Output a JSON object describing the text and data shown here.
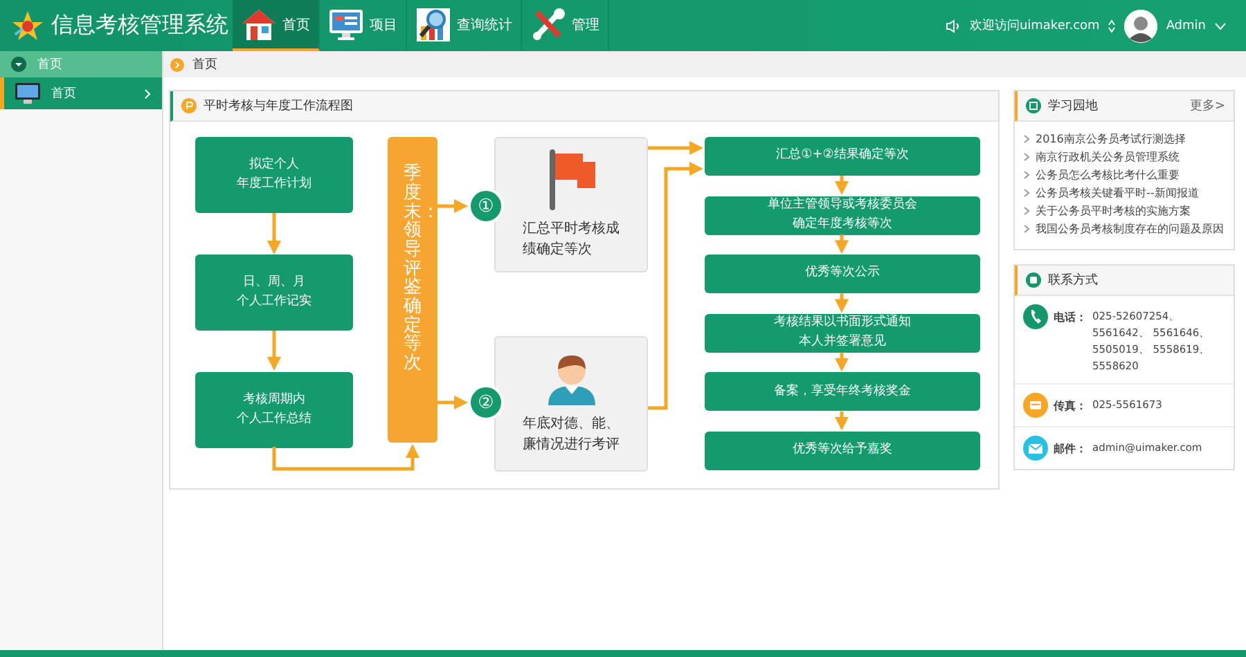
{
  "header": {
    "title": "信息考核管理系统",
    "nav": [
      {
        "label": "首页",
        "kind": "home",
        "selected": true
      },
      {
        "label": "项目",
        "kind": "project",
        "selected": false
      },
      {
        "label": "查询统计",
        "kind": "stats",
        "selected": false
      },
      {
        "label": "管理",
        "kind": "tools",
        "selected": false
      }
    ],
    "welcome": "欢迎访问uimaker.com",
    "user": "Admin"
  },
  "sidebar": {
    "section": "首页",
    "items": [
      {
        "label": "首页",
        "selected": true
      }
    ]
  },
  "breadcrumb": "首页",
  "flow": {
    "title": "平时考核与年度工作流程图",
    "steps": [
      [
        "拟定个人",
        "年度工作计划"
      ],
      [
        "日、周、月",
        "个人工作记实"
      ],
      [
        "考核周期内",
        "个人工作总结"
      ]
    ],
    "stage": "季度末：领导评鉴确定等次",
    "branches": [
      {
        "marker": "①",
        "kind": "flag",
        "text": [
          "汇总平时考核成",
          "绩确定等次"
        ]
      },
      {
        "marker": "②",
        "kind": "person",
        "text": [
          "年底对德、能、",
          "廉情况进行考评"
        ]
      }
    ],
    "results": [
      [
        "汇总①+②结果确定等次"
      ],
      [
        "单位主管领导或考核委员会",
        "确定年度考核等次"
      ],
      [
        "优秀等次公示"
      ],
      [
        "考核结果以书面形式通知",
        "本人并签署意见"
      ],
      [
        "备案，享受年终考核奖金"
      ],
      [
        "优秀等次给予嘉奖"
      ]
    ]
  },
  "study": {
    "title": "学习园地",
    "more": "更多>",
    "links": [
      "2016南京公务员考试行测选择",
      "南京行政机关公务员管理系统",
      "公务员怎么考核比考什么重要",
      "公务员考核关键看平时--新闻报道",
      "关于公务员平时考核的实施方案",
      "我国公务员考核制度存在的问题及原因"
    ]
  },
  "contact": {
    "title": "联系方式",
    "items": [
      {
        "kind": "phone",
        "label": "电话：",
        "value": "025-52607254、\n5561642、 5561646、\n5505019、 5558619、\n5558620"
      },
      {
        "kind": "fax",
        "label": "传真：",
        "value": "025-5561673"
      },
      {
        "kind": "email",
        "label": "邮件：",
        "value": "admin@uimaker.com"
      }
    ]
  }
}
